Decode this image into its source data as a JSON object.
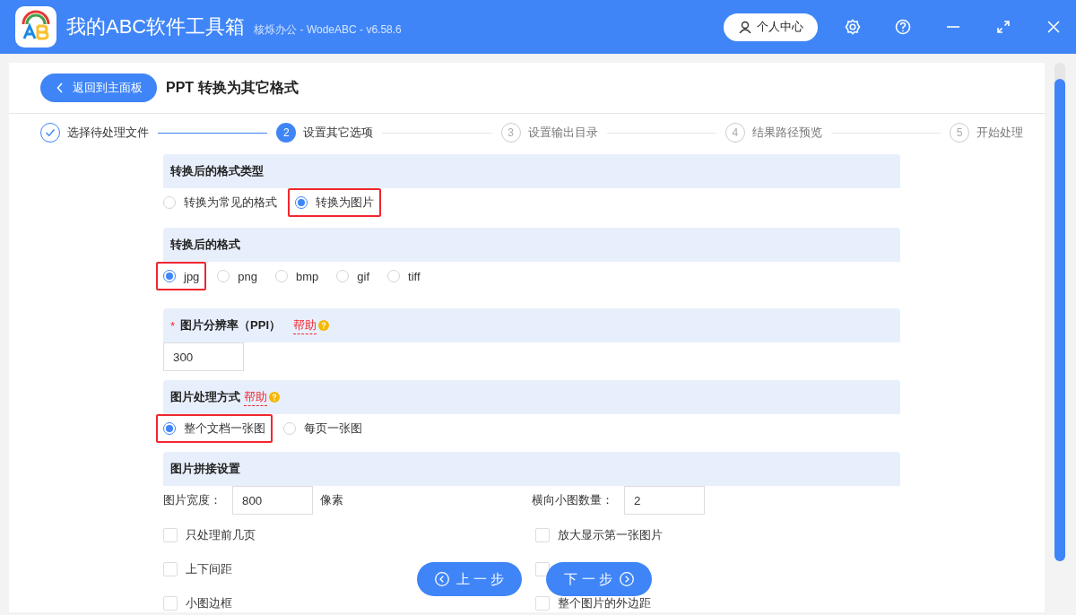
{
  "app": {
    "name": "我的ABC软件工具箱",
    "subtitle": "核烁办公 - WodeABC - v6.58.6",
    "user_button": "个人中心"
  },
  "header": {
    "back_button": "返回到主面板",
    "title": "PPT 转换为其它格式"
  },
  "steps": [
    {
      "label": "选择待处理文件",
      "kind": "done"
    },
    {
      "number": "2",
      "label": "设置其它选项",
      "kind": "current"
    },
    {
      "number": "3",
      "label": "设置输出目录",
      "kind": "todo"
    },
    {
      "number": "4",
      "label": "结果路径预览",
      "kind": "todo"
    },
    {
      "number": "5",
      "label": "开始处理",
      "kind": "todo"
    }
  ],
  "sections": [
    {
      "kind": "radio",
      "title": "转换后的格式类型",
      "options": [
        {
          "label": "转换为常见的格式",
          "selected": false,
          "highlighted": false
        },
        {
          "label": "转换为图片",
          "selected": true,
          "highlighted": true
        }
      ]
    },
    {
      "kind": "radio",
      "title": "转换后的格式",
      "options": [
        {
          "label": "jpg",
          "selected": true,
          "highlighted": true
        },
        {
          "label": "png",
          "selected": false,
          "highlighted": false
        },
        {
          "label": "bmp",
          "selected": false,
          "highlighted": false
        },
        {
          "label": "gif",
          "selected": false,
          "highlighted": false
        },
        {
          "label": "tiff",
          "selected": false,
          "highlighted": false
        }
      ]
    },
    {
      "kind": "input",
      "title": "图片分辨率（PPI）",
      "required_mark": "*",
      "help": "帮助",
      "value": "300"
    },
    {
      "kind": "radio",
      "title": "图片处理方式",
      "help": "帮助",
      "options": [
        {
          "label": "整个文档一张图",
          "selected": true,
          "highlighted": true
        },
        {
          "label": "每页一张图",
          "selected": false,
          "highlighted": false
        }
      ]
    },
    {
      "kind": "stitch",
      "title": "图片拼接设置",
      "fields": [
        {
          "label": "图片宽度：",
          "value": "800",
          "unit": "像素"
        },
        {
          "label": "横向小图数量：",
          "value": "2"
        }
      ],
      "checkboxes": [
        {
          "label": "只处理前几页",
          "checked": false
        },
        {
          "label": "放大显示第一张图片",
          "checked": false
        },
        {
          "label": "上下间距",
          "checked": false
        },
        {
          "checked": false
        },
        {
          "label": "小图边框",
          "checked": false
        },
        {
          "label": "整个图片的外边距",
          "checked": false
        }
      ]
    }
  ],
  "nav": {
    "prev": "上 一 步",
    "next": "下 一 步"
  }
}
